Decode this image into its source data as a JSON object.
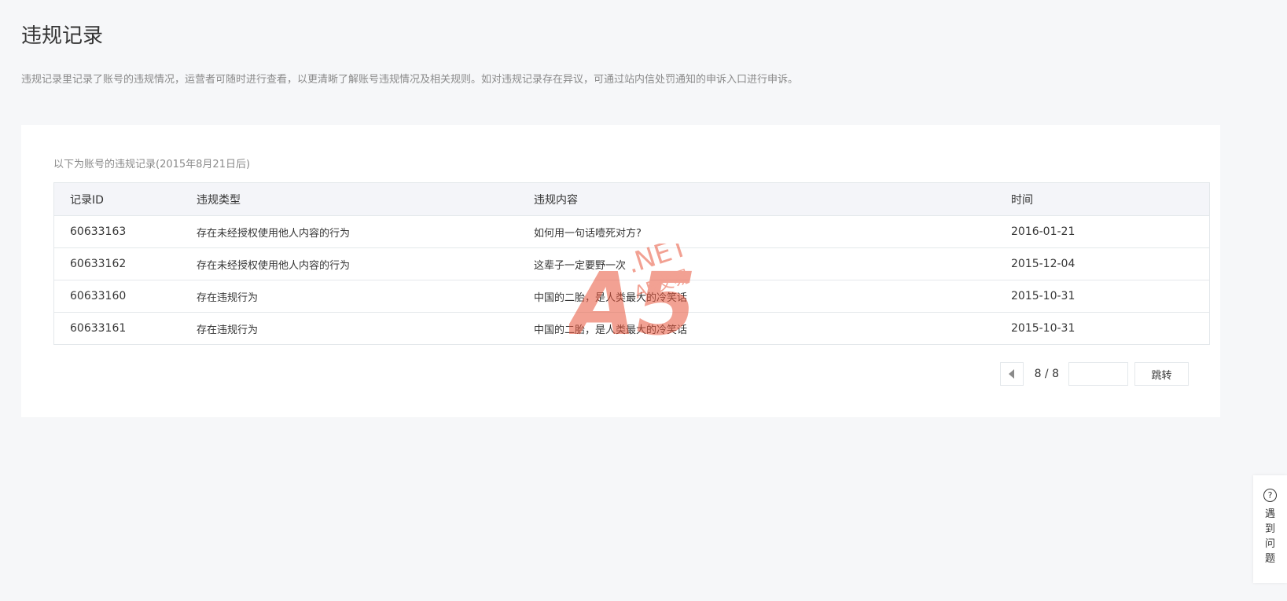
{
  "page": {
    "title": "违规记录",
    "description": "违规记录里记录了账号的违规情况，运营者可随时进行查看，以更清晰了解账号违规情况及相关规则。如对违规记录存在异议，可通过站内信处罚通知的申诉入口进行申诉。"
  },
  "records": {
    "caption": "以下为账号的违规记录(2015年8月21日后)",
    "columns": [
      "记录ID",
      "违规类型",
      "违规内容",
      "时间"
    ],
    "rows": [
      {
        "id": "60633163",
        "type": "存在未经授权使用他人内容的行为",
        "content": "如何用一句话噎死对方?",
        "time": "2016-01-21"
      },
      {
        "id": "60633162",
        "type": "存在未经授权使用他人内容的行为",
        "content": "这辈子一定要野一次",
        "time": "2015-12-04"
      },
      {
        "id": "60633160",
        "type": "存在违规行为",
        "content": "中国的二胎，是人类最大的冷笑话",
        "time": "2015-10-31"
      },
      {
        "id": "60633161",
        "type": "存在违规行为",
        "content": "中国的二胎，是人类最大的冷笑话",
        "time": "2015-10-31"
      }
    ]
  },
  "pager": {
    "page_text": "8 / 8",
    "input_value": "",
    "jump_label": "跳转",
    "prev_icon": "triangle-left-icon"
  },
  "help": {
    "icon": "question-circle-icon",
    "label": "遇到问题"
  },
  "watermark": {
    "text_main": "A5",
    "text_net": ".NET",
    "text_sub": "A5交易",
    "color": "#e8553b"
  },
  "colors": {
    "background": "#f6f7f9",
    "card": "#ffffff",
    "border": "#e4e8eb",
    "header_row": "#f4f5f9",
    "muted_text": "#8a8a8a"
  }
}
